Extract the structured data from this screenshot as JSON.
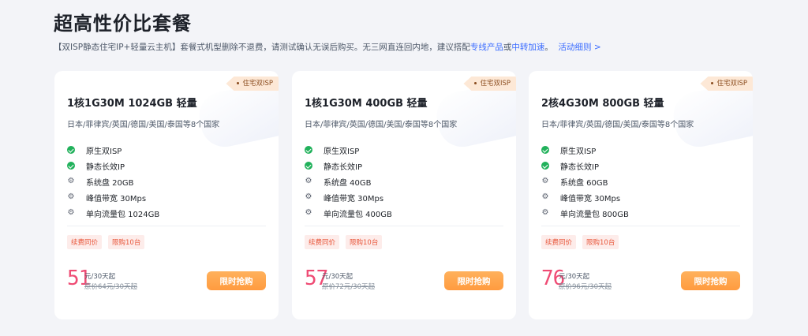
{
  "page": {
    "title": "超高性价比套餐",
    "notice_prefix": "【双ISP静态住宅IP+轻量云主机】套餐式机型删除不退费，请测试确认无误后购买。无三网直连回内地，建议搭配",
    "link_dedicated": "专线产品",
    "notice_or": "或",
    "link_relay": "中转加速",
    "notice_dot": "。",
    "link_activity": "活动细则 >"
  },
  "cards": [
    {
      "ribbon": "住宅双ISP",
      "name": "1核1G30M 1024GB 轻量",
      "regions": "日本/菲律宾/英国/德国/美国/泰国等8个国家",
      "features": [
        {
          "icon": "check-icon",
          "text": "原生双ISP"
        },
        {
          "icon": "check-icon",
          "text": "静态长效IP"
        },
        {
          "icon": "gear-icon",
          "text": "系统盘 20GB"
        },
        {
          "icon": "gear-icon",
          "text": "峰值带宽 30Mps"
        },
        {
          "icon": "gear-icon",
          "text": "单向流量包 1024GB"
        }
      ],
      "badges": [
        "续费同价",
        "限购10台"
      ],
      "price": "51",
      "unit": "元/30天起",
      "original": "原价64元/30天起",
      "button": "限时抢购"
    },
    {
      "ribbon": "住宅双ISP",
      "name": "1核1G30M 400GB 轻量",
      "regions": "日本/菲律宾/英国/德国/美国/泰国等8个国家",
      "features": [
        {
          "icon": "check-icon",
          "text": "原生双ISP"
        },
        {
          "icon": "check-icon",
          "text": "静态长效IP"
        },
        {
          "icon": "gear-icon",
          "text": "系统盘 40GB"
        },
        {
          "icon": "gear-icon",
          "text": "峰值带宽 30Mps"
        },
        {
          "icon": "gear-icon",
          "text": "单向流量包 400GB"
        }
      ],
      "badges": [
        "续费同价",
        "限购10台"
      ],
      "price": "57",
      "unit": "元/30天起",
      "original": "原价72元/30天起",
      "button": "限时抢购"
    },
    {
      "ribbon": "住宅双ISP",
      "name": "2核4G30M 800GB 轻量",
      "regions": "日本/菲律宾/英国/德国/美国/泰国等8个国家",
      "features": [
        {
          "icon": "check-icon",
          "text": "原生双ISP"
        },
        {
          "icon": "check-icon",
          "text": "静态长效IP"
        },
        {
          "icon": "gear-icon",
          "text": "系统盘 60GB"
        },
        {
          "icon": "gear-icon",
          "text": "峰值带宽 30Mps"
        },
        {
          "icon": "gear-icon",
          "text": "单向流量包 800GB"
        }
      ],
      "badges": [
        "续费同价",
        "限购10台"
      ],
      "price": "76",
      "unit": "元/30天起",
      "original": "原价96元/30天起",
      "button": "限时抢购"
    }
  ],
  "colors": {
    "accent_link": "#3b6cff",
    "price": "#ef4b74",
    "check": "#21b15b",
    "button": "#ff9b3f",
    "badge_text": "#e8563a"
  }
}
